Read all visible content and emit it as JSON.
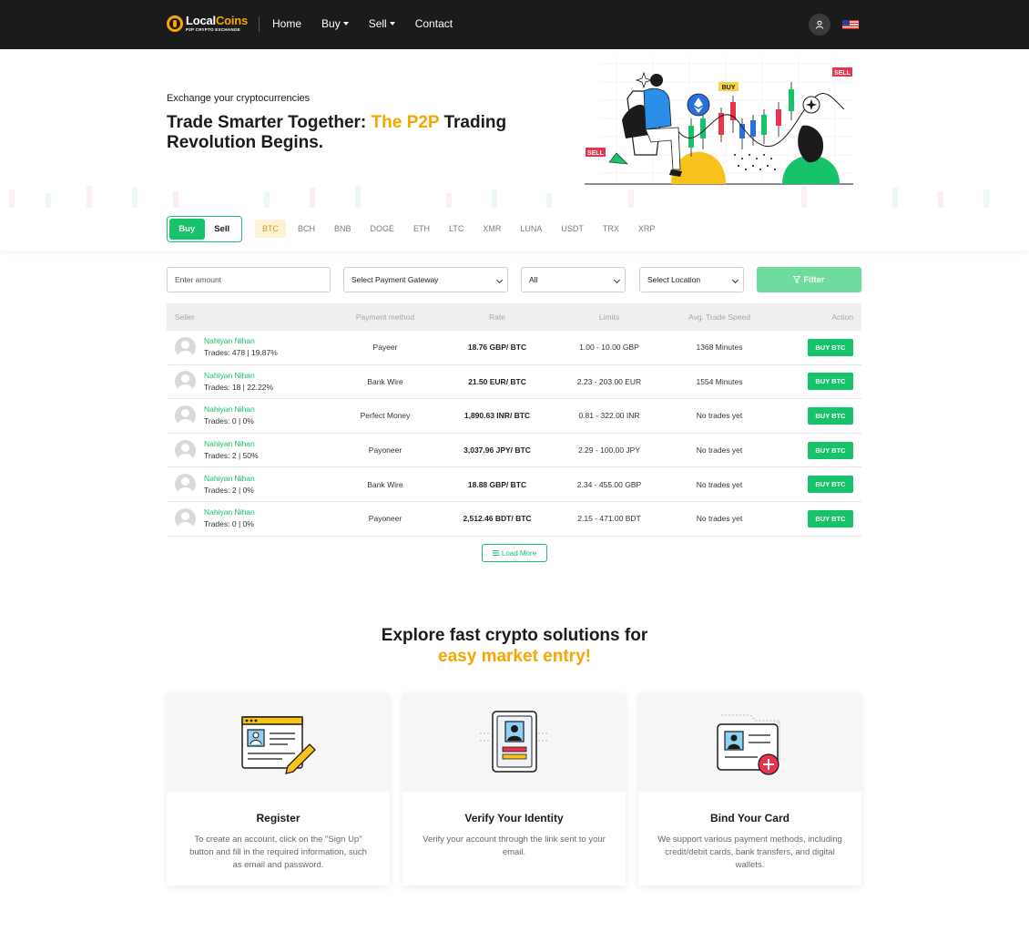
{
  "brand": {
    "name_part1": "Local",
    "name_part2": "Coins",
    "tagline": "P2P CRYPTO EXCHANGE"
  },
  "nav": {
    "items": [
      "Home",
      "Buy",
      "Sell",
      "Contact"
    ]
  },
  "colors": {
    "accent": "#f7a600",
    "green": "#16c26a",
    "dark": "#1b1b1b"
  },
  "hero": {
    "kicker": "Exchange your cryptocurrencies",
    "title_a": "Trade Smarter Together: ",
    "title_highlight": "The P2P",
    "title_b": " Trading Revolution Begins.",
    "art_labels": {
      "sell": "SELL",
      "buy": "BUY"
    }
  },
  "trade_toggle": {
    "buy": "Buy",
    "sell": "Sell"
  },
  "coins": [
    "BTC",
    "BCH",
    "BNB",
    "DOGE",
    "ETH",
    "LTC",
    "XMR",
    "LUNA",
    "USDT",
    "TRX",
    "XRP"
  ],
  "filters": {
    "amount_placeholder": "Enter amount",
    "gateway": "Select Payment Gateway",
    "type": "All",
    "location": "Select Location",
    "filter_label": "Filter"
  },
  "table": {
    "headers": [
      "Seller",
      "Payment method",
      "Rate",
      "Limits",
      "Avg. Trade Speed",
      "Action"
    ],
    "rows": [
      {
        "seller": "Nahiyan Nihan",
        "trades": "Trades: 478 | 19.87%",
        "payment": "Payeer",
        "rate": "18.76 GBP/ BTC",
        "limits": "1.00 - 10.00 GBP",
        "speed": "1368 Minutes",
        "action": "BUY BTC"
      },
      {
        "seller": "Nahiyan Nihan",
        "trades": "Trades: 18 | 22.22%",
        "payment": "Bank Wire",
        "rate": "21.50 EUR/ BTC",
        "limits": "2.23 - 203.00 EUR",
        "speed": "1554 Minutes",
        "action": "BUY BTC"
      },
      {
        "seller": "Nahiyan Nihan",
        "trades": "Trades: 0 | 0%",
        "payment": "Perfect Money",
        "rate": "1,890.63 INR/ BTC",
        "limits": "0.81 - 322.00 INR",
        "speed": "No trades yet",
        "action": "BUY BTC"
      },
      {
        "seller": "Nahiyan Nihan",
        "trades": "Trades: 2 | 50%",
        "payment": "Payoneer",
        "rate": "3,037.96 JPY/ BTC",
        "limits": "2.29 - 100.00 JPY",
        "speed": "No trades yet",
        "action": "BUY BTC"
      },
      {
        "seller": "Nahiyan Nihan",
        "trades": "Trades: 2 | 0%",
        "payment": "Bank Wire",
        "rate": "18.88 GBP/ BTC",
        "limits": "2.34 - 455.00 GBP",
        "speed": "No trades yet",
        "action": "BUY BTC"
      },
      {
        "seller": "Nahiyan Nihan",
        "trades": "Trades: 0 | 0%",
        "payment": "Payoneer",
        "rate": "2,512.46 BDT/ BTC",
        "limits": "2.15 - 471.00 BDT",
        "speed": "No trades yet",
        "action": "BUY BTC"
      }
    ]
  },
  "load_more": "Load More",
  "explore": {
    "title_a": "Explore fast crypto solutions for",
    "title_highlight": "easy market entry!",
    "cards": [
      {
        "title": "Register",
        "desc": "To create an account, click on the \"Sign Up\" button and fill in the required information, such as email and password.",
        "icon": "register-form-icon"
      },
      {
        "title": "Verify Your Identity",
        "desc": "Verify your account through the link sent to your email.",
        "icon": "id-card-icon"
      },
      {
        "title": "Bind Your Card",
        "desc": "We support various payment methods, including credit/debit cards, bank transfers, and digital wallets.",
        "icon": "add-card-icon"
      }
    ]
  }
}
